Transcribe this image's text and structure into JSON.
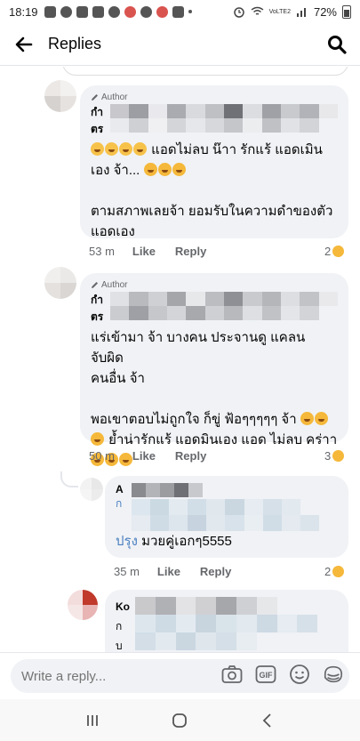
{
  "status": {
    "time": "18:19",
    "network": "VoLTE2",
    "battery": "72%"
  },
  "header": {
    "title": "Replies"
  },
  "comments": [
    {
      "author_label": "Author",
      "name_prefix": "กำ",
      "name_prefix2": "ตร",
      "text_line1": "แอดไม่ลบ น๊าา รักแร้ แอดเมิน",
      "text_line2": "เอง จ้า...",
      "text_line3": "ตามสภาพเลยจ้า ยอมรับในความดำของตัว",
      "text_line4": "แอดเอง",
      "time": "53 m",
      "like": "Like",
      "reply": "Reply",
      "reactions": "2"
    },
    {
      "author_label": "Author",
      "name_prefix": "กำ",
      "name_prefix2": "ตร",
      "text_line1": "แร่เข้ามา  จ้า บางคน ประจานดู แคลน จับผิด",
      "text_line2": "คนอื่น จ้า",
      "text_line3": "พอเขาตอบไม่ถูกใจ ก็ขู่ ฟ้อๆๆๆๆๆ จ้า",
      "text_line4": "ย้ำน่ารักแร้ แอดมินเอง แอด ไม่ลบ คร่าา",
      "time": "50 m",
      "like": "Like",
      "reply": "Reply",
      "reactions": "3"
    },
    {
      "name_prefix": "A",
      "name_prefix2": "ก",
      "text_prefix": "ปรุง",
      "text_line1": "มวยคู่เอกๆ5555",
      "time": "35 m",
      "like": "Like",
      "reply": "Reply",
      "reactions": "2"
    },
    {
      "name_prefix": "Ko",
      "name_prefix2": "ก",
      "name_prefix3": "บ"
    }
  ],
  "reply_bar": {
    "placeholder": "Write a reply..."
  },
  "colors": {
    "bubble": "#f0f2f5",
    "meta": "#65676b",
    "text": "#050505",
    "emoji": "#f5b83a"
  }
}
